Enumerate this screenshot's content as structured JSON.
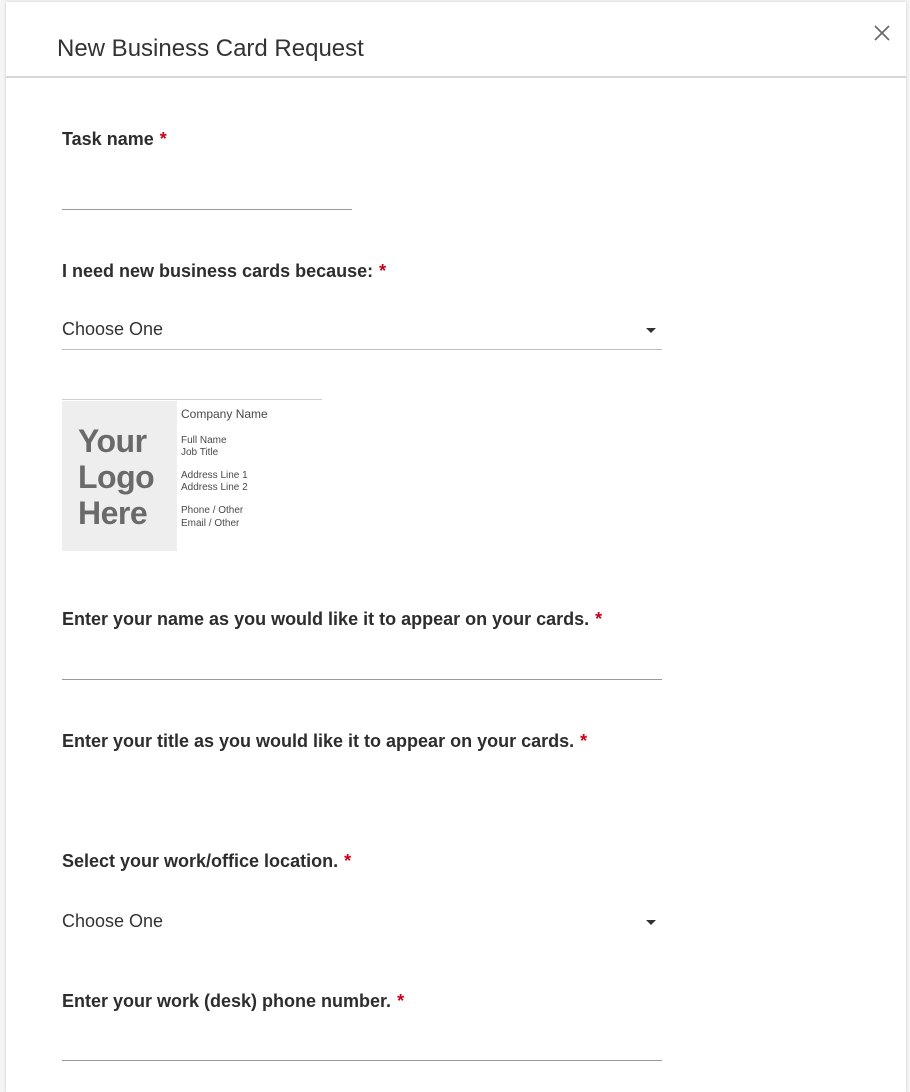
{
  "dialog": {
    "title": "New Business Card Request"
  },
  "required_marker": "*",
  "fields": {
    "task_name": {
      "label": "Task name",
      "value": ""
    },
    "reason": {
      "label": "I need new business cards because:",
      "selected": "Choose One"
    },
    "name": {
      "label": "Enter your name as you would like it to appear on your cards.",
      "value": ""
    },
    "title": {
      "label": "Enter your title as you would like it to appear on your cards.",
      "value": ""
    },
    "location": {
      "label": "Select your work/office location.",
      "selected": "Choose One"
    },
    "phone": {
      "label": "Enter your work (desk) phone number.",
      "value": ""
    }
  },
  "card_preview": {
    "logo_lines": [
      "Your",
      "Logo",
      "Here"
    ],
    "company": "Company Name",
    "full_name": "Full Name",
    "job_title": "Job Title",
    "address_1": "Address Line 1",
    "address_2": "Address Line 2",
    "phone": "Phone / Other",
    "email": "Email / Other"
  },
  "icons": {
    "close": "close-icon",
    "dropdown": "caret-down-icon"
  }
}
